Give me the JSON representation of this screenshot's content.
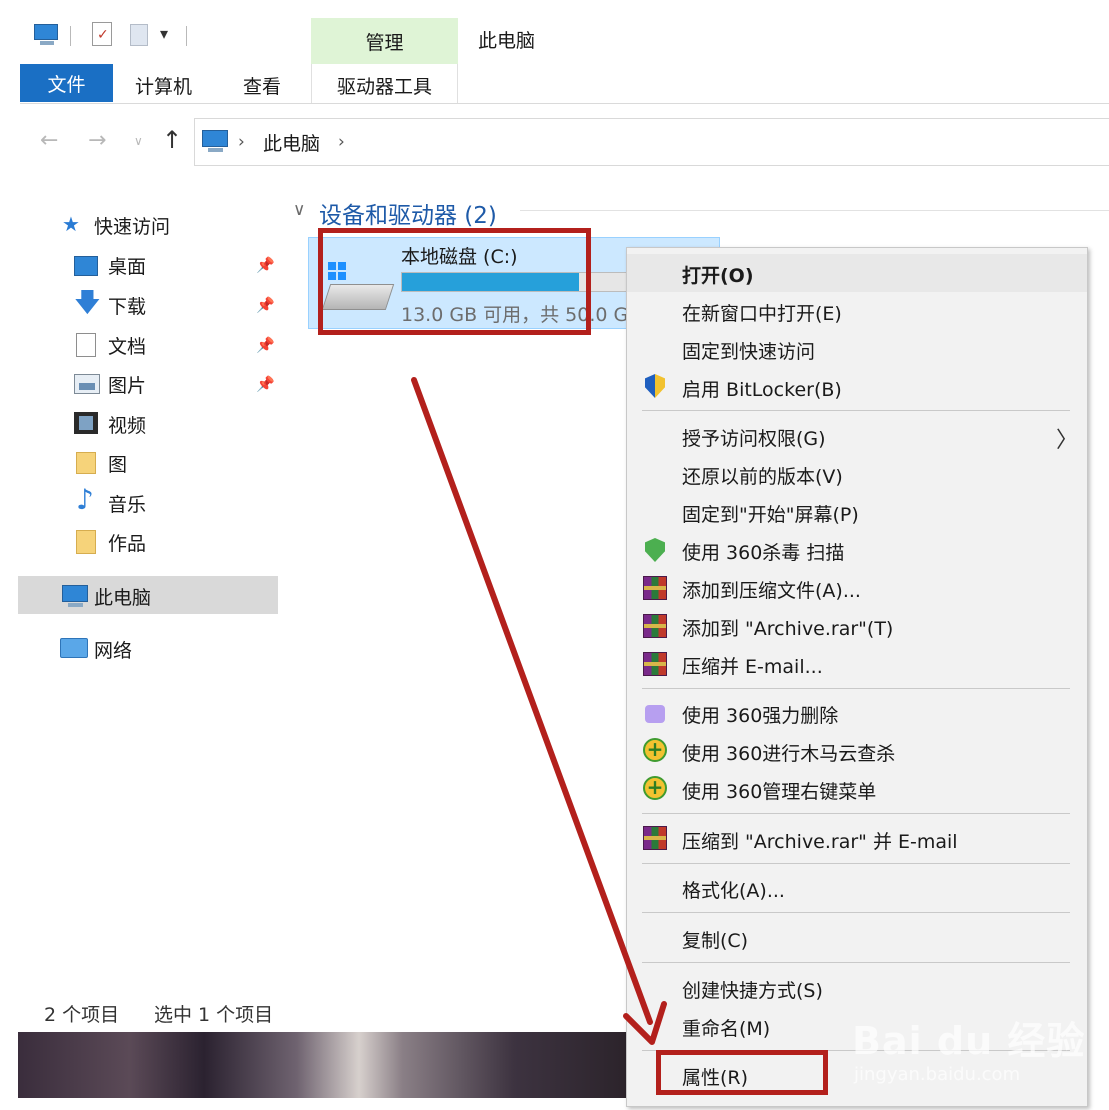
{
  "window": {
    "title": "此电脑",
    "context_tab": "管理"
  },
  "ribbon": {
    "tabs": [
      {
        "label": "文件",
        "active": true
      },
      {
        "label": "计算机"
      },
      {
        "label": "查看"
      },
      {
        "label": "驱动器工具"
      }
    ]
  },
  "quick_access_toolbar": {
    "icons": [
      "computer-icon",
      "properties-icon",
      "new-folder-icon",
      "customize-dropdown-icon"
    ],
    "dropdown_glyph": "▾"
  },
  "address_bar": {
    "back_glyph": "←",
    "forward_glyph": "→",
    "recent_glyph": "∨",
    "up_glyph": "↑",
    "chevron": "›",
    "location": "此电脑"
  },
  "nav_pane": {
    "pin_glyph": "📌",
    "quick_access": "快速访问",
    "items": [
      {
        "label": "桌面",
        "pinned": true
      },
      {
        "label": "下载",
        "pinned": true
      },
      {
        "label": "文档",
        "pinned": true
      },
      {
        "label": "图片",
        "pinned": true
      },
      {
        "label": "视频"
      },
      {
        "label": "图"
      },
      {
        "label": "音乐"
      },
      {
        "label": "作品"
      }
    ],
    "this_pc": "此电脑",
    "network": "网络"
  },
  "content": {
    "group_chevron": "∨",
    "group_title": "设备和驱动器 (2)",
    "drive": {
      "name": "本地磁盘 (C:)",
      "free_text": "13.0 GB 可用，共 5",
      "free_text_hidden_part": "0.0 G",
      "used_fraction": 0.79
    }
  },
  "status_bar": {
    "count": "2 个项目",
    "selected": "选中 1 个项目"
  },
  "context_menu": {
    "items": [
      {
        "label": "打开(O)",
        "bold": true
      },
      {
        "label": "在新窗口中打开(E)"
      },
      {
        "label": "固定到快速访问"
      },
      {
        "label": "启用 BitLocker(B)",
        "icon": "bitlocker-shield-icon"
      },
      {
        "label": "授予访问权限(G)",
        "submenu": true
      },
      {
        "label": "还原以前的版本(V)"
      },
      {
        "label": "固定到\"开始\"屏幕(P)"
      },
      {
        "label": "使用 360杀毒 扫描",
        "icon": "360-antivirus-icon"
      },
      {
        "label": "添加到压缩文件(A)...",
        "icon": "winrar-icon"
      },
      {
        "label": "添加到 \"Archive.rar\"(T)",
        "icon": "winrar-icon"
      },
      {
        "label": "压缩并 E-mail...",
        "icon": "winrar-icon"
      },
      {
        "label": "使用 360强力删除",
        "icon": "360-delete-icon"
      },
      {
        "label": "使用 360进行木马云查杀",
        "icon": "360-trojan-icon"
      },
      {
        "label": "使用 360管理右键菜单",
        "icon": "360-menu-icon"
      },
      {
        "label": "压缩到 \"Archive.rar\" 并 E-mail",
        "icon": "winrar-icon"
      },
      {
        "label": "格式化(A)..."
      },
      {
        "label": "复制(C)"
      },
      {
        "label": "创建快捷方式(S)"
      },
      {
        "label": "重命名(M)"
      },
      {
        "label": "属性(R)"
      }
    ],
    "submenu_arrow": "〉"
  },
  "annotation": {
    "color": "#b3201c"
  },
  "watermark": {
    "logo": "Bai du 经验",
    "url": "jingyan.baidu.com"
  }
}
